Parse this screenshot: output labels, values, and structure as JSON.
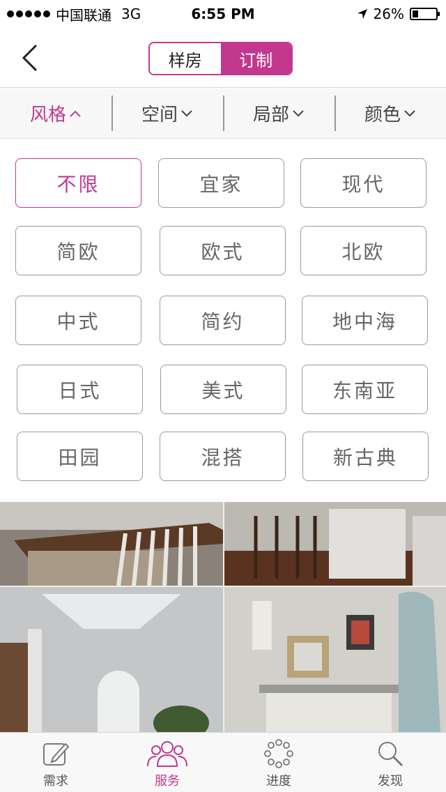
{
  "status_bar": {
    "carrier": "中国联通",
    "network": "3G",
    "time": "6:55 PM",
    "battery": "26%",
    "battery_level": 0.26
  },
  "nav": {
    "segments": [
      "样房",
      "订制"
    ],
    "active_segment": 1
  },
  "filters": [
    {
      "label": "风格",
      "active": true
    },
    {
      "label": "空间",
      "active": false
    },
    {
      "label": "局部",
      "active": false
    },
    {
      "label": "颜色",
      "active": false
    }
  ],
  "styles": [
    "不限",
    "宜家",
    "现代",
    "简欧",
    "欧式",
    "北欧",
    "中式",
    "简约",
    "地中海",
    "日式",
    "美式",
    "东南亚",
    "田园",
    "混搭",
    "新古典"
  ],
  "selected_style": "不限",
  "tabs": [
    {
      "label": "需求",
      "icon": "edit-icon"
    },
    {
      "label": "服务",
      "icon": "people-icon"
    },
    {
      "label": "进度",
      "icon": "progress-icon"
    },
    {
      "label": "发现",
      "icon": "search-icon"
    }
  ],
  "colors": {
    "accent": "#c3388f"
  }
}
